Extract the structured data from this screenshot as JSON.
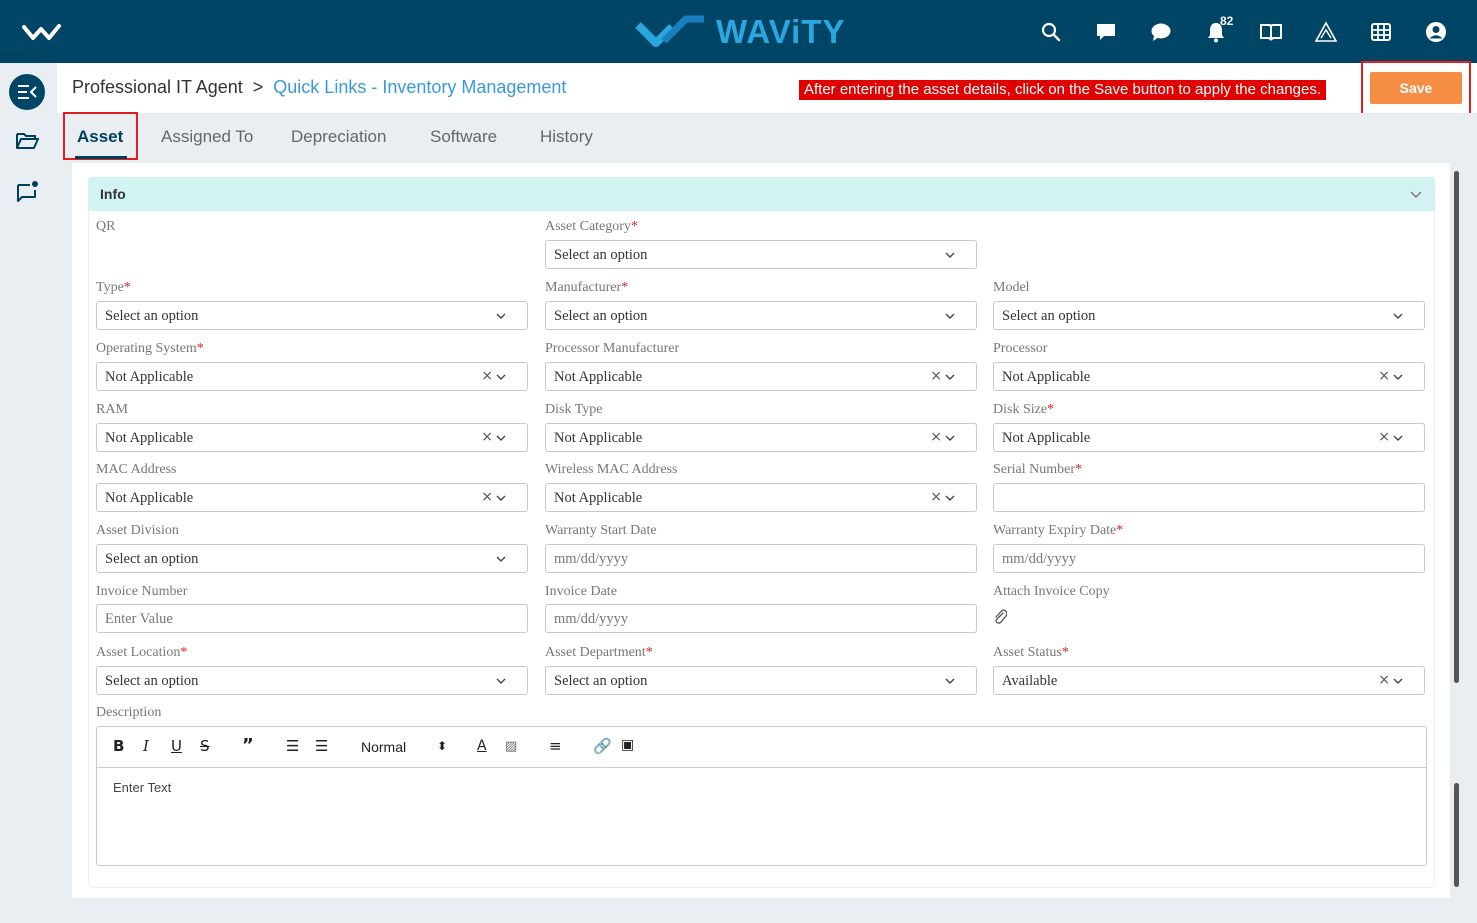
{
  "brand": {
    "name": "WAViTY"
  },
  "topbar": {
    "notifications_count": "82"
  },
  "breadcrumb": {
    "root": "Professional IT Agent",
    "separator": ">",
    "current": "Quick Links - Inventory Management"
  },
  "instruction": "After entering the asset details, click on the Save button to apply the changes.",
  "save_label": "Save",
  "tabs": [
    "Asset",
    "Assigned To",
    "Depreciation",
    "Software",
    "History"
  ],
  "section": {
    "title": "Info"
  },
  "fields": {
    "qr": {
      "label": "QR"
    },
    "asset_category": {
      "label": "Asset Category",
      "value": "Select an option"
    },
    "type": {
      "label": "Type",
      "value": "Select an option"
    },
    "manufacturer": {
      "label": "Manufacturer",
      "value": "Select an option"
    },
    "model": {
      "label": "Model",
      "value": "Select an option"
    },
    "operating_system": {
      "label": "Operating System",
      "value": "Not Applicable"
    },
    "processor_manufacturer": {
      "label": "Processor Manufacturer",
      "value": "Not Applicable"
    },
    "processor": {
      "label": "Processor",
      "value": "Not Applicable"
    },
    "ram": {
      "label": "RAM",
      "value": "Not Applicable"
    },
    "disk_type": {
      "label": "Disk Type",
      "value": "Not Applicable"
    },
    "disk_size": {
      "label": "Disk Size",
      "value": "Not Applicable"
    },
    "mac_address": {
      "label": "MAC Address",
      "value": "Not Applicable"
    },
    "wireless_mac": {
      "label": "Wireless MAC Address",
      "value": "Not Applicable"
    },
    "serial_number": {
      "label": "Serial Number",
      "value": ""
    },
    "asset_division": {
      "label": "Asset Division",
      "value": "Select an option"
    },
    "warranty_start": {
      "label": "Warranty Start Date",
      "placeholder": "mm/dd/yyyy"
    },
    "warranty_expiry": {
      "label": "Warranty Expiry Date",
      "placeholder": "mm/dd/yyyy"
    },
    "invoice_number": {
      "label": "Invoice Number",
      "placeholder": "Enter Value"
    },
    "invoice_date": {
      "label": "Invoice Date",
      "placeholder": "mm/dd/yyyy"
    },
    "attach_invoice": {
      "label": "Attach Invoice Copy"
    },
    "asset_location": {
      "label": "Asset Location",
      "value": "Select an option"
    },
    "asset_department": {
      "label": "Asset Department",
      "value": "Select an option"
    },
    "asset_status": {
      "label": "Asset Status",
      "value": "Available"
    },
    "description": {
      "label": "Description",
      "placeholder": "Enter Text"
    }
  },
  "editor_toolbar": {
    "heading": "Normal"
  },
  "colors": {
    "topbar": "#004466",
    "brand": "#29a8e0",
    "save": "#f58d45",
    "instruction_bg": "#e00000",
    "link": "#3a9ad9",
    "section_head": "#d3f3f3"
  },
  "icons": [
    "menu-logo-icon",
    "search-icon",
    "chat-icon",
    "message-icon",
    "bell-icon",
    "book-icon",
    "triangle-logo-icon",
    "grid-icon",
    "user-icon",
    "sidebar-toggle-icon",
    "folder-icon",
    "feedback-icon",
    "chevron-down-icon",
    "clear-icon",
    "paperclip-icon"
  ]
}
